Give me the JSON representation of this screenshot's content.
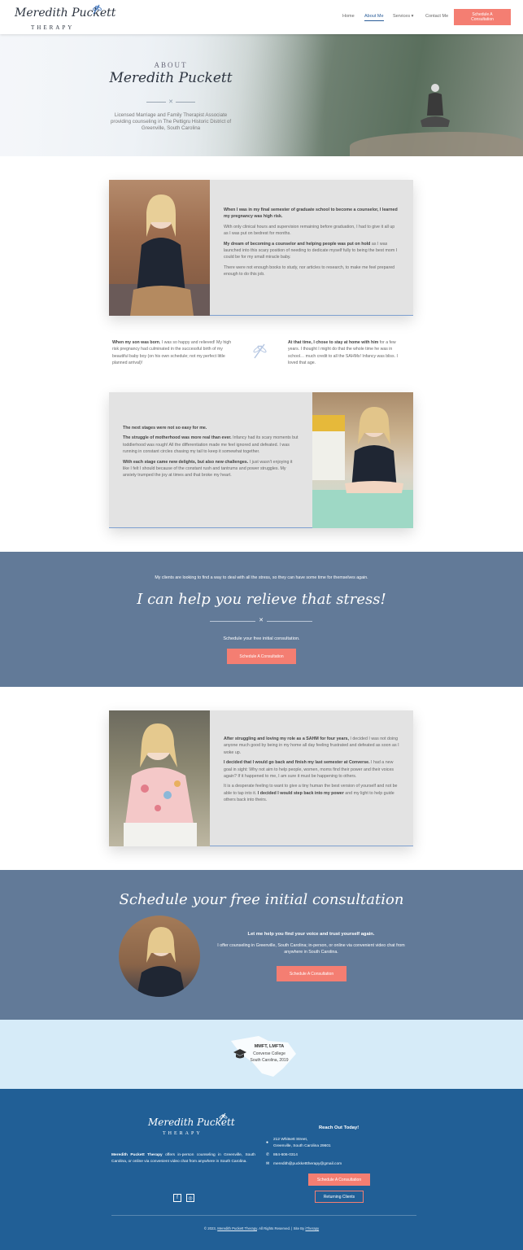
{
  "header": {
    "logo_script": "Meredith Puckett",
    "logo_sub": "THERAPY",
    "nav": {
      "home": "Home",
      "about": "About Me",
      "services": "Services",
      "contact": "Contact Me"
    },
    "cta": "Schedule A Consultation"
  },
  "hero": {
    "eyebrow": "ABOUT",
    "name": "Meredith Puckett",
    "subtitle": "Licensed Marriage and Family Therapist Associate providing counseling in The Pettigru Historic District of Greenville, South Carolina"
  },
  "story1": {
    "p1_bold": "When I was in my final semester of graduate school to become a counselor, I learned my pregnancy was high risk.",
    "p2": "With only clinical hours and supervision remaining before graduation, I had to give it all up as I was put on bedrest for months.",
    "p3_bold": "My dream of becoming a counselor and helping people was put on hold",
    "p3_rest": " as I was launched into this scary position of needing to dedicate myself fully to being the best mom I could be for my small miracle baby.",
    "p4": "There were not enough books to study, nor articles to research, to make me feel prepared enough to do this job."
  },
  "twocol": {
    "left_bold": "When my son was born",
    "left_rest": ", I was so happy and relieved! My high risk pregnancy had culminated in the successful birth of my beautiful baby boy (on his own schedule; not my perfect little planned arrival)!",
    "right_bold": "At that time, I chose to stay at home with him",
    "right_rest": " for a few years. I thought I might do that the whole time he was in school… much credit to all the SAHMs! Infancy was bliss. I loved that age."
  },
  "story2": {
    "p1_bold": "The next stages were not so easy for me.",
    "p2_bold": "The struggle of motherhood was more real than ever.",
    "p2_rest": " Infancy had its scary moments but toddlerhood was rough! All the differentiation made me feel ignored and defeated. I was running in constant circles chasing my tail to keep it somewhat together.",
    "p3_bold": "With each stage came new delights, but also new challenges.",
    "p3_rest": " I just wasn't enjoying it like I felt I should because of the constant rush and tantrums and power struggles. My anxiety trumped the joy at times and that broke my heart."
  },
  "band1": {
    "intro": "My clients are looking to find a way to deal with all the stress, so they can have some time for themselves again.",
    "headline": "I can help you relieve that stress!",
    "sub": "Schedule your free initial consultation.",
    "button": "Schedule A Consultation"
  },
  "story3": {
    "p1_bold": "After struggling and loving my role as a SAHM for four years,",
    "p1_rest": " I decided I was not doing anyone much good by being in my home all day feeling frustrated and defeated as soon as I woke up.",
    "p2_bold": "I decided that I would go back and finish my last semester at Converse.",
    "p2_rest": " I had a new goal in sight: Why not aim to help people, women, moms find their power and their voices again? If it happened to me, I am sure it must be happening to others.",
    "p3_a": "It is a desperate feeling to want to give a tiny human the best version of yourself and not be able to tap into it. ",
    "p3_bold": "I decided I would step back into my power",
    "p3_rest": " and my light to help guide others back into theirs."
  },
  "band2": {
    "headline": "Schedule your free initial consultation",
    "lead": "Let me help you find your voice and trust yourself again.",
    "body": "I offer counseling in Greenville, South Carolina; in-person, or online via convenient video chat from anywhere in South Carolina.",
    "button": "Schedule A Consultation"
  },
  "education": {
    "degree": "MMFT, LMFTA",
    "school": "Converse College",
    "place": "South Carolina, 2019"
  },
  "footer": {
    "logo_script": "Meredith Puckett",
    "logo_sub": "THERAPY",
    "desc_bold": "Meredith Puckett Therapy",
    "desc_rest": " offers in-person counseling in Greenville, South Carolina, or online via convenient video chat from anywhere in South Carolina.",
    "reach": "Reach Out Today!",
    "address1": "212 Whitsett Street,",
    "address2": "Greenville, South Carolina 29601",
    "phone": "864-606-0314",
    "email": "meredith@puckketttherapy@gmail.com",
    "cta": "Schedule A Consultation",
    "returning": "Returning Clients",
    "copyright_a": "© 2023,",
    "copyright_link": "Meredith Puckett Therapy",
    "copyright_b": ". All Rights Reserved.   |   Site By",
    "site_by": "iTherapy"
  },
  "colors": {
    "accent": "#f47e72",
    "band": "#627a98",
    "footer": "#215f96",
    "edu": "#d6ebf8",
    "nav_active": "#2a5d99"
  }
}
